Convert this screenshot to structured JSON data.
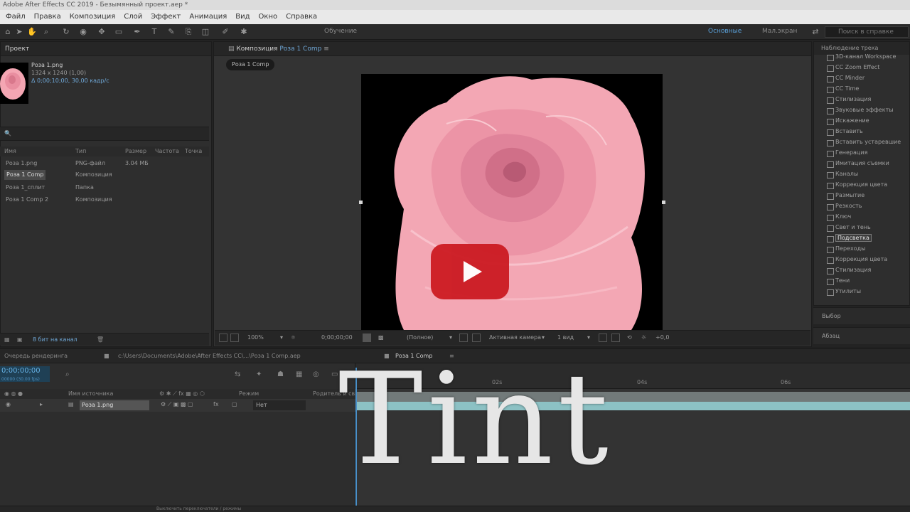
{
  "window": {
    "title": "Adobe After Effects CC 2019 - Безымянный проект.aep *"
  },
  "menu": [
    "Файл",
    "Правка",
    "Композиция",
    "Слой",
    "Эффект",
    "Анимация",
    "Вид",
    "Окно",
    "Справка"
  ],
  "toolbar": {
    "workspace_label": "Обучение",
    "workspace_active": "Основные",
    "workspace_third": "Мал.экран",
    "search_placeholder": "Поиск в справке"
  },
  "project": {
    "tab_label": "Проект",
    "item_name": "Роза 1.png",
    "item_size": "1324 x 1240 (1,00)",
    "item_info": "Δ 0;00;10;00, 30,00 кадр/с",
    "search_placeholder": "🔍",
    "columns": [
      "Имя",
      "Тип",
      "Размер",
      "Частота",
      "Точка"
    ],
    "rows": [
      {
        "name": "Роза 1.png",
        "type": "PNG-файл",
        "size": "3.04 МБ",
        "highlight": false
      },
      {
        "name": "Роза 1 Comp",
        "type": "Композиция",
        "size": "",
        "highlight": true
      },
      {
        "name": "Роза 1_сплит",
        "type": "Папка",
        "size": "",
        "highlight": false
      },
      {
        "name": "Роза 1 Comp 2",
        "type": "Композиция",
        "size": "",
        "highlight": false
      }
    ],
    "footer_bits": "8 бит на канал"
  },
  "composition": {
    "tab_label": "Композиция",
    "tab_name": "Роза 1 Comp",
    "badge": "Роза 1 Comp",
    "zoom": "100%",
    "timecode": "0;00;00;00",
    "resolution": "(Полное)",
    "camera": "Активная камера",
    "views": "1 вид",
    "exposure": "+0,0"
  },
  "effects": {
    "header": "Наблюдение трека",
    "items": [
      "3D-канал Workspace",
      "CC Zoom Effect",
      "CC Minder",
      "CC Time",
      "Стилизация",
      "Звуковые эффекты",
      "Искажение",
      "Вставить",
      "Вставить устаревшие",
      "Генерация",
      "Имитация съемки",
      "Каналы",
      "Коррекция цвета",
      "Размытие",
      "Резкость",
      "Ключ",
      "Свет и тень",
      "Переходы",
      "Подсветка",
      "Коррекция цвета",
      "Стилизация",
      "Тени",
      "Утилиты"
    ],
    "selected_index": 18,
    "lower_label_1": "Выбор",
    "lower_label_2": "Абзац"
  },
  "timeline": {
    "tab_render": "Очередь рендеринга",
    "tab_path": "c:\\Users\\Documents\\Adobe\\After Effects CC\\...\\Роза 1 Comp.aep",
    "tab_comp": "Роза 1 Comp",
    "timecode": "0;00;00;00",
    "timecode_sub": "00000 (30.00 fps)",
    "col_source": "Имя источника",
    "col_mode": "Режим",
    "col_parent": "Родитель и связь",
    "layer_name": "Роза 1.png",
    "layer_mode": "Нет",
    "ruler": [
      "02s",
      "04s",
      "06s"
    ],
    "bottom_label": "Выключить переключатели / режимы"
  },
  "overlay": {
    "title": "Tint"
  },
  "colors": {
    "accent": "#5aa0d8",
    "youtube_red": "#cc1a22"
  }
}
